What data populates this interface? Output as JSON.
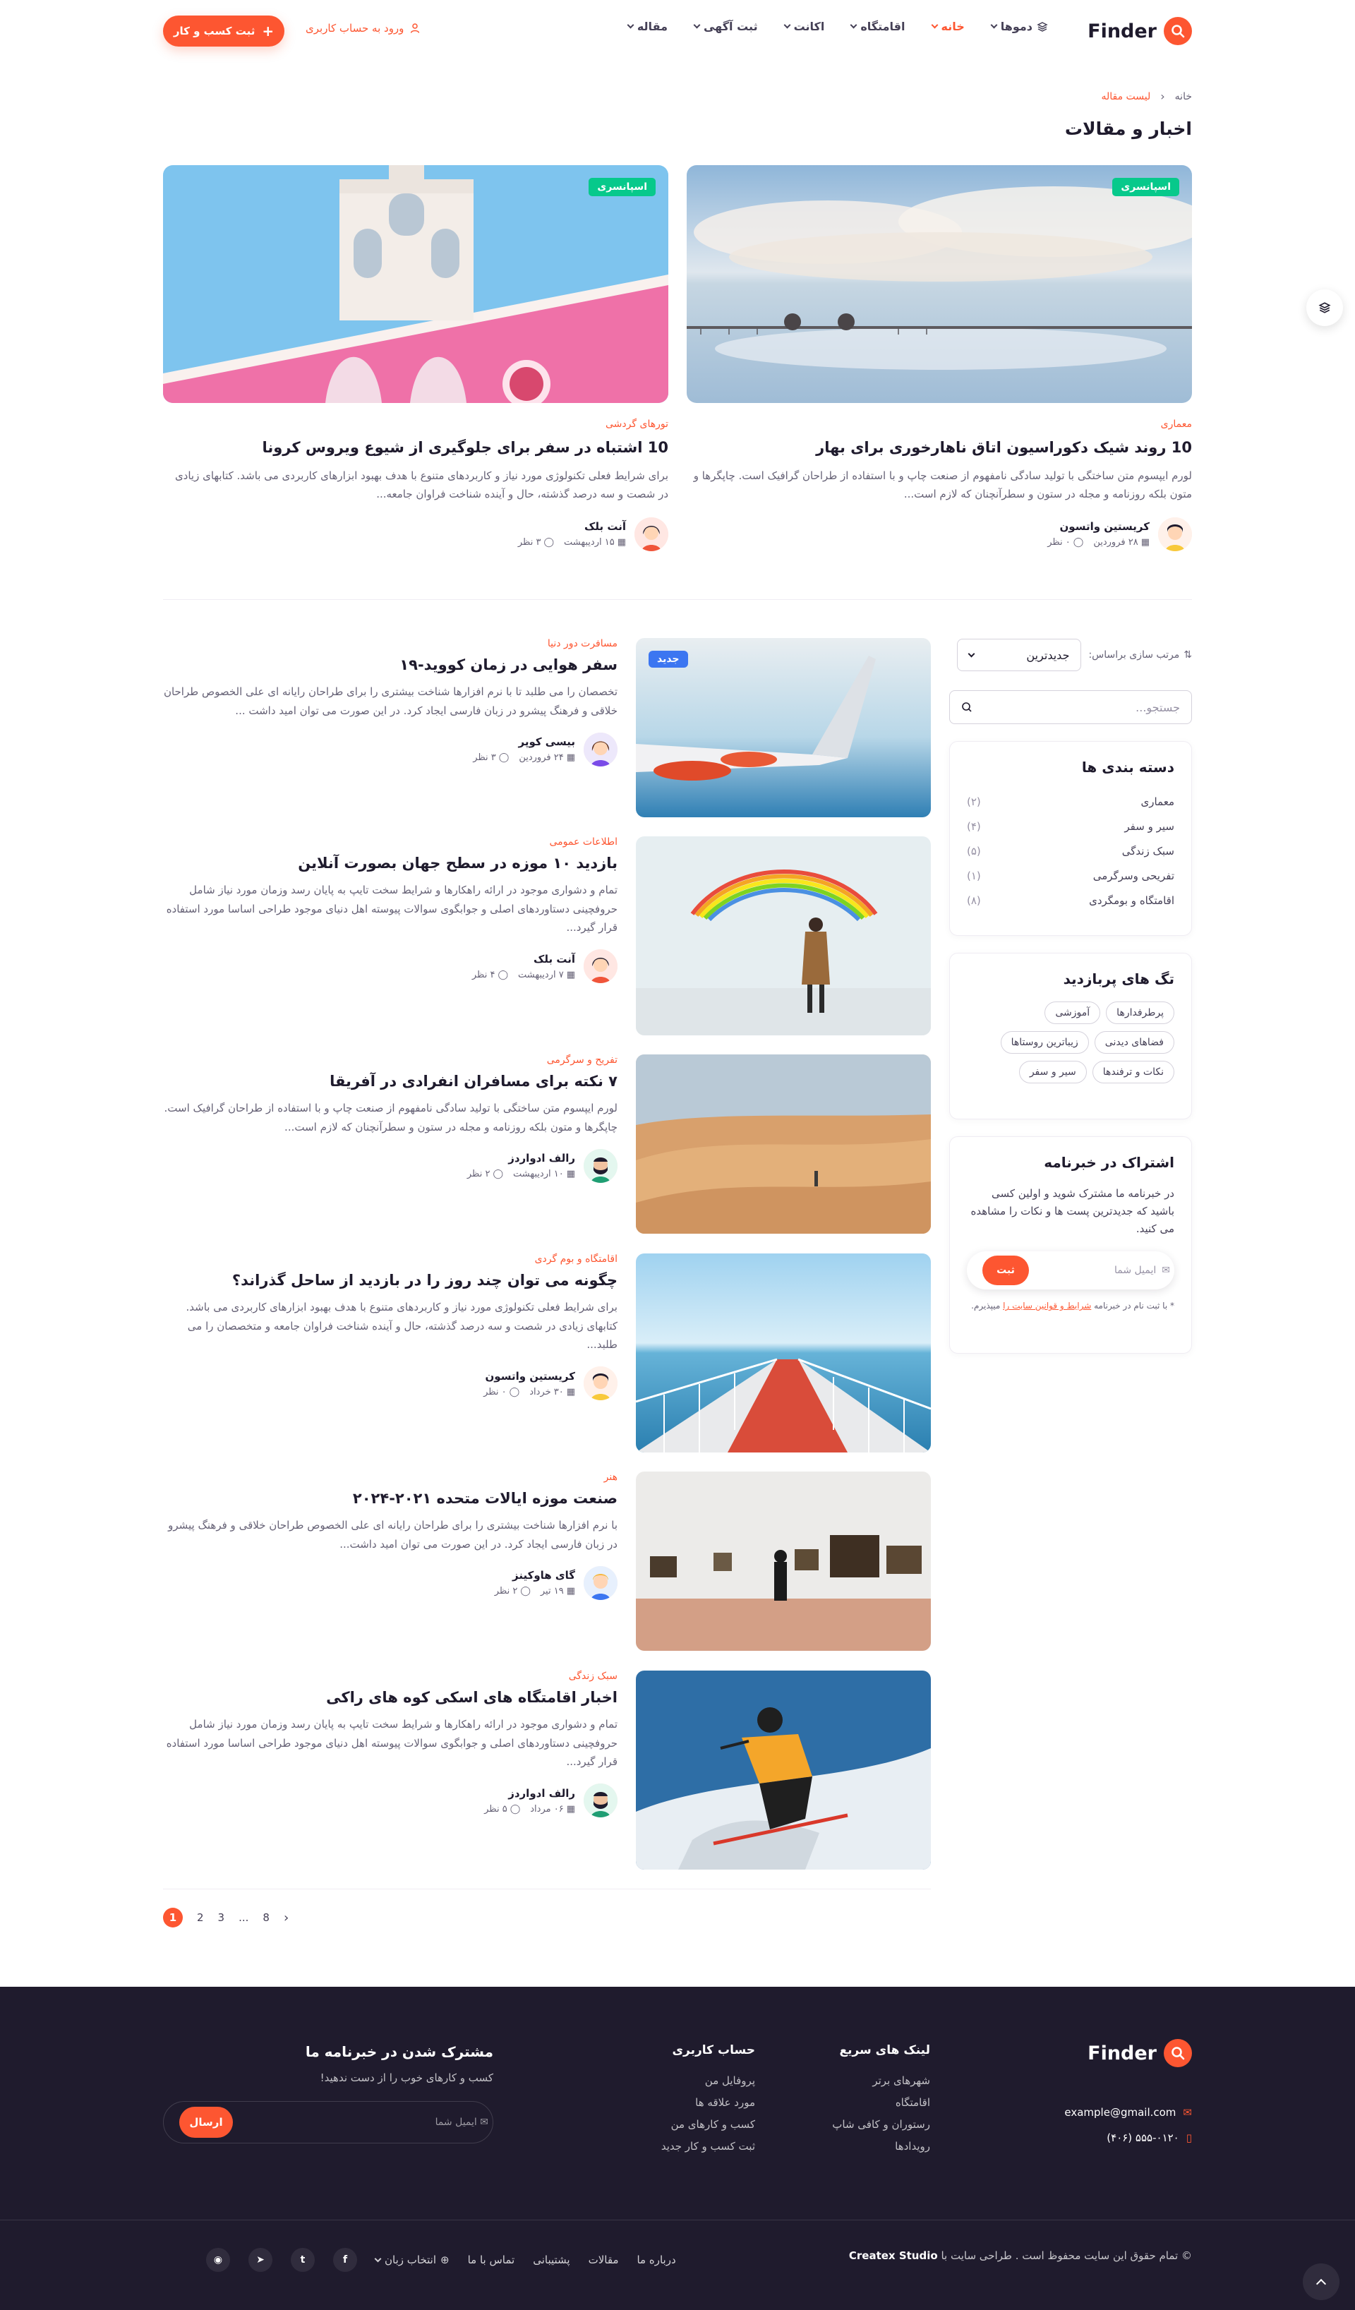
{
  "header": {
    "brand": "Finder",
    "nav": [
      {
        "label": "دموها",
        "active": false
      },
      {
        "label": "خانه",
        "active": true
      },
      {
        "label": "اقامتگاه",
        "active": false
      },
      {
        "label": "اکانت",
        "active": false
      },
      {
        "label": "ثبت آگهی",
        "active": false
      },
      {
        "label": "مقاله",
        "active": false
      }
    ],
    "login": "ورود به حساب کاربری",
    "cta": "ثبت کسب و کار"
  },
  "breadcrumb": {
    "home": "خانه",
    "current": "لیست مقاله"
  },
  "page_title": "اخبار و مقالات",
  "featured": [
    {
      "badge": "اسپانسری",
      "category": "معماری",
      "title": "10 روند شیک دکوراسیون اتاق ناهارخوری برای بهار",
      "text": "لورم ایپسوم متن ساختگی با تولید سادگی نامفهوم از صنعت چاپ و با استفاده از طراحان گرافیک است. چاپگرها و متون بلکه روزنامه و مجله در ستون و سطرآنچنان که لازم است...",
      "author": "کریستین واتسون",
      "date": "۲۸ فروردین",
      "comments": "۰ نظر"
    },
    {
      "badge": "اسپانسری",
      "category": "تورهای گردشی",
      "title": "10 اشتباه در سفر برای جلوگیری از شیوع ویروس کرونا",
      "text": "برای شرایط فعلی تکنولوژی مورد نیاز و کاربردهای متنوع با هدف بهبود ابزارهای کاربردی می باشد. کتابهای زیادی در شصت و سه درصد گذشته، حال و آینده شناخت فراوان جامعه...",
      "author": "آنت بلک",
      "date": "۱۵ اردیبهشت",
      "comments": "۳ نظر"
    }
  ],
  "sidebar": {
    "sort_label": "مرتب سازی براساس:",
    "sort_value": "جدیدترین",
    "search_placeholder": "جستجو...",
    "categories_title": "دسته بندی ها",
    "categories": [
      {
        "name": "معماری",
        "count": "(۲)"
      },
      {
        "name": "سیر و سفر",
        "count": "(۴)"
      },
      {
        "name": "سبک زندگی",
        "count": "(۵)"
      },
      {
        "name": "تفریحی وسرگرمی",
        "count": "(۱)"
      },
      {
        "name": "اقامتگاه و بومگردی",
        "count": "(۸)"
      }
    ],
    "tags_title": "تگ های پربازدید",
    "tags": [
      "پرطرفدارها",
      "آموزشی",
      "فضاهای دیدنی",
      "زیباترین روستاها",
      "نکات و ترفندها",
      "سیر و سفر"
    ],
    "newsletter_title": "اشتراک در خبرنامه",
    "newsletter_text": "در خبرنامه ما مشترک شوید و اولین کسی باشید که جدیدترین پست ها و نکات را مشاهده می کنید.",
    "newsletter_placeholder": "ایمیل شما",
    "newsletter_button": "ثبت",
    "newsletter_note_pre": "* با ثبت نام در خبرنامه",
    "newsletter_note_link": "شرایط و قوانین سایت را",
    "newsletter_note_post": "میپذیرم."
  },
  "posts": [
    {
      "badge": "جدید",
      "category": "مسافرت دور دنیا",
      "title": "سفر هوایی در زمان کووید-۱۹",
      "text": "تخصصان را می طلبد تا با نرم افزارها شناخت بیشتری را برای طراحان رایانه ای علی الخصوص طراحان خلاقی و فرهنگ پیشرو در زبان فارسی ایجاد کرد. در این صورت می توان امید داشت ...",
      "author": "بیسی کوپر",
      "date": "۲۴ فروردین",
      "comments": "۳ نظر"
    },
    {
      "badge": "",
      "category": "اطلاعات عمومی",
      "title": "بازدید ۱۰ موزه در سطح جهان بصورت آنلاین",
      "text": "تمام و دشواری موجود در ارائه راهکارها و شرایط سخت تایپ به پایان رسد وزمان مورد نیاز شامل حروفچینی دستاوردهای اصلی و جوابگوی سوالات پیوسته اهل دنیای موجود طراحی اساسا مورد استفاده قرار گیرد...",
      "author": "آنت بلک",
      "date": "۷ اردیبهشت",
      "comments": "۴ نظر"
    },
    {
      "badge": "",
      "category": "تفریح و سرگرمی",
      "title": "۷ نکته برای مسافران انفرادی در آفریقا",
      "text": "لورم ایپسوم متن ساختگی با تولید سادگی نامفهوم از صنعت چاپ و با استفاده از طراحان گرافیک است. چاپگرها و متون بلکه روزنامه و مجله در ستون و سطرآنچنان که لازم است...",
      "author": "رالف ادواردز",
      "date": "۱۰ اردیبهشت",
      "comments": "۲ نظر"
    },
    {
      "badge": "",
      "category": "اقامتگاه و بوم گردی",
      "title": "چگونه می توان چند روز را در بازدید از ساحل گذراند؟",
      "text": "برای شرایط فعلی تکنولوژی مورد نیاز و کاربردهای متنوع با هدف بهبود ابزارهای کاربردی می باشد. کتابهای زیادی در شصت و سه درصد گذشته، حال و آینده شناخت فراوان جامعه و متخصصان را می طلبد...",
      "author": "کریستین واتسون",
      "date": "۳۰ خرداد",
      "comments": "۰ نظر"
    },
    {
      "badge": "",
      "category": "هنر",
      "title": "صنعت موزه ایالات متحده ۲۰۲۱-۲۰۲۴",
      "text": "با نرم افزارها شناخت بیشتری را برای طراحان رایانه ای علی الخصوص طراحان خلاقی و فرهنگ پیشرو در زبان فارسی ایجاد کرد. در این صورت می توان امید داشت...",
      "author": "گای هاوکینز",
      "date": "۱۹ تیر",
      "comments": "۲ نظر"
    },
    {
      "badge": "",
      "category": "سبک زندگی",
      "title": "اخبار اقامتگاه های اسکی کوه های راکی",
      "text": "تمام و دشواری موجود در ارائه راهکارها و شرایط سخت تایپ به پایان رسد وزمان مورد نیاز شامل حروفچینی دستاوردهای اصلی و جوابگوی سوالات پیوسته اهل دنیای موجود طراحی اساسا مورد استفاده قرار گیرد...",
      "author": "رالف ادواردز",
      "date": "۰۶ مرداد",
      "comments": "۵ نظر"
    }
  ],
  "pagination": {
    "current": "1",
    "pages": [
      "2",
      "3",
      "...",
      "8"
    ]
  },
  "footer": {
    "brand": "Finder",
    "email": "example@gmail.com",
    "phone": "(۴۰۶) ۵۵۵-۰۱۲۰",
    "quick_title": "لینک های سریع",
    "quick_links": [
      "شهرهای برتر",
      "اقامتگاه",
      "رستوران و کافی شاپ",
      "رویدادها"
    ],
    "account_title": "حساب کاربری",
    "account_links": [
      "پروفایل من",
      "مورد علاقه ها",
      "کسب و کارهای من",
      "ثبت کسب و کار جدید"
    ],
    "subscribe_title": "مشترک شدن در خبرنامه ما",
    "subscribe_text": "کسب و کارهای خوب را از دست ندهید!",
    "subscribe_placeholder": "ایمیل شما",
    "subscribe_button": "ارسال",
    "copyright": "© تمام حقوق این سایت محفوظ است . طراحی سایت با",
    "copyright_brand": "Createx Studio",
    "links": [
      "درباره ما",
      "مقالات",
      "پشتیبانی",
      "تماس با ما"
    ],
    "language": "انتخاب زبان"
  },
  "colors": {
    "accent": "#fd5631",
    "dark": "#1f1b2d",
    "green": "#07c98b",
    "blue": "#3c76f1"
  }
}
